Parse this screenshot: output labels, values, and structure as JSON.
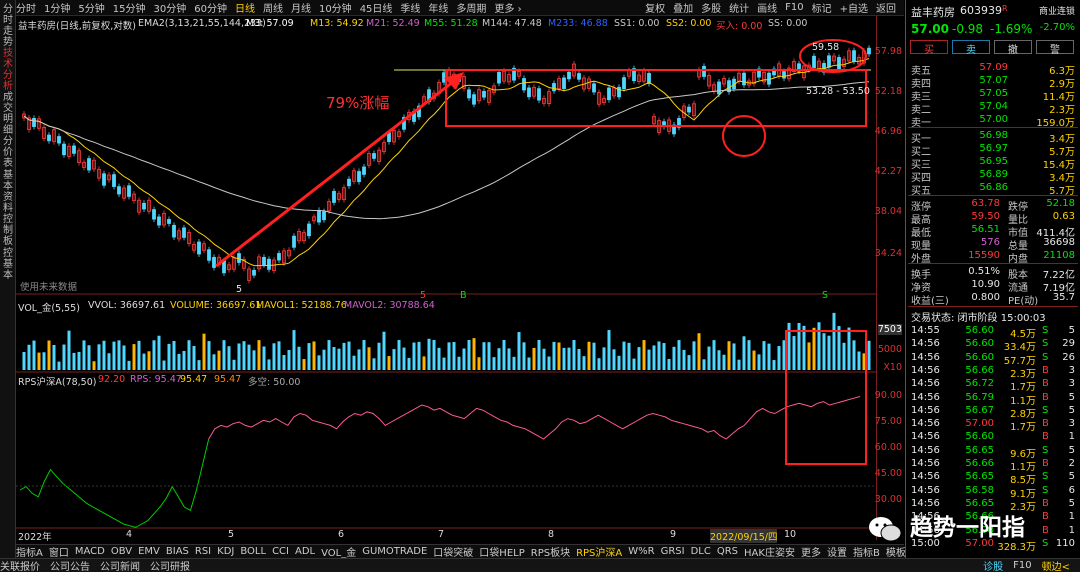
{
  "left_tabs": [
    "分时走势",
    "技术分析",
    "成交明细",
    "分价表",
    "基本资料",
    "控制板",
    "控基本"
  ],
  "toolbar": {
    "periods": [
      "分时",
      "1分钟",
      "5分钟",
      "15分钟",
      "30分钟",
      "60分钟",
      "日线",
      "周线",
      "月线",
      "10分钟",
      "45日线",
      "季线",
      "年线",
      "多周期",
      "更多 ›"
    ],
    "right_items": [
      "复权",
      "叠加",
      "多股",
      "统计",
      "画线",
      "F10",
      "标记",
      "+自选",
      "返回"
    ]
  },
  "chart": {
    "title": "益丰药房(日线,前复权,对数)",
    "ema_label": "EMA2(3,13,21,55,144,233)",
    "ma_values": [
      {
        "label": "M3: 57.09",
        "color": "#ffffff"
      },
      {
        "label": "M13: 54.92",
        "color": "#ffd200"
      },
      {
        "label": "M21: 52.49",
        "color": "#d060d0"
      },
      {
        "label": "M55: 51.28",
        "color": "#00e600"
      },
      {
        "label": "M144: 47.48",
        "color": "#c8c8c8"
      },
      {
        "label": "M233: 46.88",
        "color": "#3060ff"
      },
      {
        "label": "SS1: 0.00",
        "color": "#c8c8c8"
      },
      {
        "label": "SS2: 0.00",
        "color": "#ffd200"
      },
      {
        "label": "买入: 0.00",
        "color": "#ff3b3b"
      },
      {
        "label": "SS: 0.00",
        "color": "#c8c8c8"
      }
    ],
    "y_ticks": [
      "57.98",
      "52.18",
      "46.96",
      "42.27",
      "38.04",
      "34.24"
    ],
    "annotation": "79%涨幅",
    "high_label": "59.58",
    "range_label": "53.28 - 53.50",
    "low_label": "5",
    "future_hint": "使用未来数据",
    "x_labels": [
      "2022年",
      "4",
      "5",
      "6",
      "7",
      "8",
      "9",
      "2022/09/15/四",
      "10"
    ],
    "markers": [
      "5",
      "B",
      "S"
    ],
    "volume": {
      "label": "VOL_金(5,55)",
      "vvol": "VVOL: 36697.61",
      "volume": "VOLUME: 36697.61",
      "mavol1": "MAVOL1: 52188.76",
      "mavol2": "MAVOL2: 30788.64",
      "y_ticks": [
        "7503",
        "5000",
        "X10"
      ]
    },
    "rps": {
      "label": "RPS沪深A(78,50)",
      "v1": "92.20",
      "v2": "RPS: 95.47",
      "v3": "95.47",
      "v4": "95.47",
      "v5": "多空: 50.00",
      "y_ticks": [
        "90.00",
        "75.00",
        "60.00",
        "45.00",
        "30.00"
      ],
      "values": [
        40,
        42,
        38,
        36,
        45,
        52,
        48,
        44,
        41,
        38,
        35,
        32,
        30,
        28,
        26,
        24,
        22,
        20,
        19,
        18,
        20,
        22,
        26,
        30,
        35,
        42,
        36,
        30,
        28,
        40,
        55,
        70,
        76,
        78,
        77,
        79,
        80,
        78,
        77,
        79,
        81,
        80,
        82,
        80,
        78,
        83,
        85,
        84,
        81,
        80,
        79,
        78,
        76,
        80,
        83,
        85,
        84,
        86,
        85,
        82,
        78,
        80,
        82,
        84,
        86,
        88,
        90,
        89,
        87,
        88,
        86,
        84,
        83,
        82,
        85,
        88,
        87,
        85,
        83,
        81,
        80,
        78,
        77,
        76,
        74,
        72,
        70,
        73,
        76,
        80,
        82,
        81,
        79,
        80,
        82,
        84,
        82,
        80,
        78,
        76,
        78,
        80,
        82,
        84,
        85,
        84,
        83,
        81,
        80,
        79,
        78,
        77,
        76,
        74,
        75,
        72,
        70,
        73,
        76,
        78,
        82,
        86,
        88,
        86,
        85,
        87,
        89,
        90,
        91,
        90,
        89,
        91,
        92,
        90,
        91,
        92,
        93,
        94,
        95
      ]
    }
  },
  "right_panel": {
    "name": "益丰药房",
    "code": "603939",
    "badge": "R",
    "sector": "商业连锁",
    "price": "57.00",
    "change": "-0.98",
    "pct": "-1.69%",
    "sector_pct": "-2.70%",
    "buttons": [
      "买",
      "卖",
      "撤",
      "警"
    ],
    "asks": [
      {
        "label": "卖五",
        "price": "57.09",
        "vol": "6.3万"
      },
      {
        "label": "卖四",
        "price": "57.07",
        "vol": "2.9万"
      },
      {
        "label": "卖三",
        "price": "57.05",
        "vol": "11.4万"
      },
      {
        "label": "卖二",
        "price": "57.04",
        "vol": "2.3万"
      },
      {
        "label": "卖一",
        "price": "57.00",
        "vol": "159.0万"
      }
    ],
    "bids": [
      {
        "label": "买一",
        "price": "56.98",
        "vol": "3.4万"
      },
      {
        "label": "买二",
        "price": "56.97",
        "vol": "5.7万"
      },
      {
        "label": "买三",
        "price": "56.95",
        "vol": "15.4万"
      },
      {
        "label": "买四",
        "price": "56.89",
        "vol": "3.4万"
      },
      {
        "label": "买五",
        "price": "56.86",
        "vol": "5.7万"
      }
    ],
    "stats": [
      {
        "k1": "涨停",
        "v1": "63.78",
        "k2": "跌停",
        "v2": "52.18"
      },
      {
        "k1": "最高",
        "v1": "59.50",
        "k2": "量比",
        "v2": "0.63"
      },
      {
        "k1": "最低",
        "v1": "56.51",
        "k2": "市值",
        "v2": "411.4亿"
      },
      {
        "k1": "现量",
        "v1": "576",
        "k2": "总量",
        "v2": "36698"
      },
      {
        "k1": "外盘",
        "v1": "15590",
        "k2": "内盘",
        "v2": "21108"
      },
      {
        "k1": "换手",
        "v1": "0.51%",
        "k2": "股本",
        "v2": "7.22亿"
      },
      {
        "k1": "净资",
        "v1": "10.90",
        "k2": "流通",
        "v2": "7.19亿"
      },
      {
        "k1": "收益(三)",
        "v1": "0.800",
        "k2": "PE(动)",
        "v2": "35.7"
      }
    ],
    "trade_status": "交易状态: 闭市阶段 15:00:03",
    "ticks": [
      {
        "t": "14:55",
        "p": "56.60",
        "v": "4.5万",
        "s": "S",
        "n": "5"
      },
      {
        "t": "14:56",
        "p": "56.60",
        "v": "33.4万",
        "s": "S",
        "n": "29"
      },
      {
        "t": "14:56",
        "p": "56.60",
        "v": "57.7万",
        "s": "S",
        "n": "26"
      },
      {
        "t": "14:56",
        "p": "56.66",
        "v": "2.3万",
        "s": "B",
        "n": "3"
      },
      {
        "t": "14:56",
        "p": "56.72",
        "v": "1.7万",
        "s": "B",
        "n": "3"
      },
      {
        "t": "14:56",
        "p": "56.79",
        "v": "1.1万",
        "s": "B",
        "n": "5"
      },
      {
        "t": "14:56",
        "p": "56.67",
        "v": "2.8万",
        "s": "S",
        "n": "5"
      },
      {
        "t": "14:56",
        "p": "57.00",
        "v": "1.7万",
        "s": "B",
        "n": "3"
      },
      {
        "t": "14:56",
        "p": "56.60",
        "v": "",
        "s": "B",
        "n": "1"
      },
      {
        "t": "14:56",
        "p": "56.65",
        "v": "9.6万",
        "s": "S",
        "n": "5"
      },
      {
        "t": "14:56",
        "p": "56.66",
        "v": "1.1万",
        "s": "B",
        "n": "2"
      },
      {
        "t": "14:56",
        "p": "56.65",
        "v": "8.5万",
        "s": "S",
        "n": "5"
      },
      {
        "t": "14:56",
        "p": "56.58",
        "v": "9.1万",
        "s": "S",
        "n": "6"
      },
      {
        "t": "14:56",
        "p": "56.65",
        "v": "2.3万",
        "s": "B",
        "n": "5"
      },
      {
        "t": "14:56",
        "p": "56.66",
        "v": "",
        "s": "B",
        "n": "1"
      },
      {
        "t": "14:56",
        "p": "56.98",
        "v": "",
        "s": "B",
        "n": "1"
      },
      {
        "t": "15:00",
        "p": "57.00",
        "v": "328.3万",
        "s": "S",
        "n": "110"
      }
    ]
  },
  "bottom_tabs": [
    "指标A",
    "窗口",
    "MACD",
    "OBV",
    "EMV",
    "BIAS",
    "RSI",
    "KDJ",
    "BOLL",
    "CCI",
    "ADL",
    "VOL_金",
    "GUMOTRADE",
    "口袋突破",
    "口袋HELP",
    "RPS板块",
    "RPS沪深A",
    "W%R",
    "GRSI",
    "DLC",
    "QRS",
    "HAK庄姿安",
    "更多",
    "设置"
  ],
  "bottom_right": [
    "指标B",
    "模板"
  ],
  "statusbar": [
    "关联报价",
    "公司公告",
    "公司新闻",
    "公司研报"
  ],
  "statusbar_right": [
    "诊股",
    "F10",
    "顿边<"
  ],
  "watermark": "趋势一阳指"
}
